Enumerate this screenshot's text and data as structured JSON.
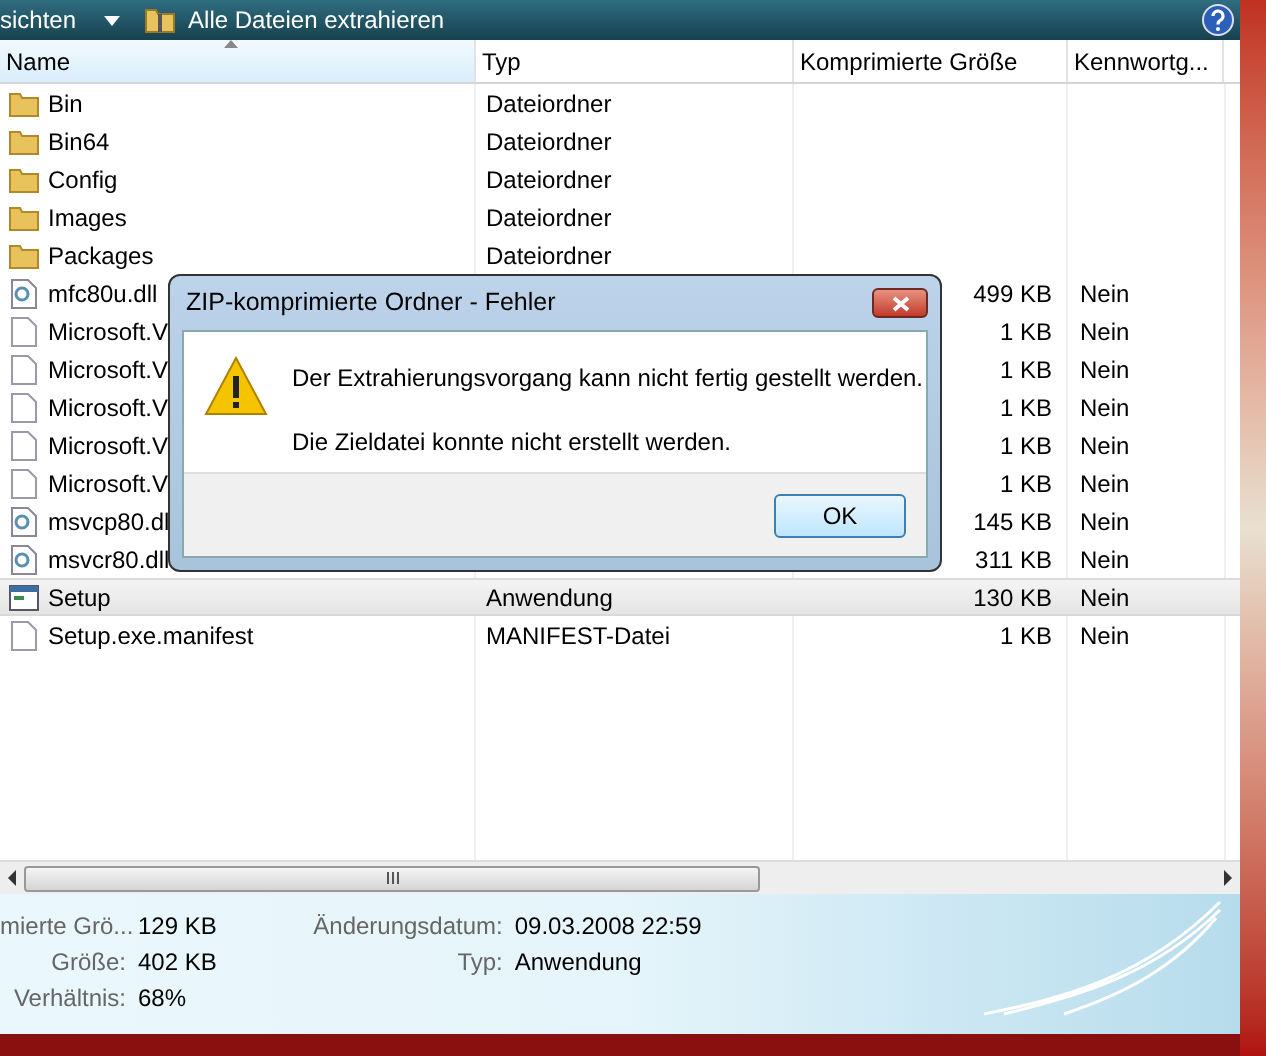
{
  "toolbar": {
    "items": [
      {
        "kind": "menu",
        "label": "sichten"
      },
      {
        "kind": "extract",
        "label": "Alle Dateien extrahieren"
      }
    ]
  },
  "table": {
    "columns": [
      "Name",
      "Typ",
      "Komprimierte Größe",
      "Kennwortg..."
    ],
    "rows": [
      {
        "kind": "folder",
        "name": "Bin",
        "type": "Dateiordner",
        "selected": false
      },
      {
        "kind": "folder",
        "name": "Bin64",
        "type": "Dateiordner",
        "selected": false
      },
      {
        "kind": "folder",
        "name": "Config",
        "type": "Dateiordner",
        "selected": false
      },
      {
        "kind": "folder",
        "name": "Images",
        "type": "Dateiordner",
        "selected": false
      },
      {
        "kind": "folder",
        "name": "Packages",
        "type": "Dateiordner",
        "selected": false
      },
      {
        "kind": "dll",
        "name": "mfc80u.dll",
        "size": "499 KB",
        "password": "Nein",
        "selected": false
      },
      {
        "kind": "file",
        "name": "Microsoft.V",
        "size": "1 KB",
        "password": "Nein",
        "selected": false
      },
      {
        "kind": "file",
        "name": "Microsoft.V",
        "size": "1 KB",
        "password": "Nein",
        "selected": false
      },
      {
        "kind": "file",
        "name": "Microsoft.V",
        "size": "1 KB",
        "password": "Nein",
        "selected": false
      },
      {
        "kind": "file",
        "name": "Microsoft.V",
        "size": "1 KB",
        "password": "Nein",
        "selected": false
      },
      {
        "kind": "file",
        "name": "Microsoft.V",
        "size": "1 KB",
        "password": "Nein",
        "selected": false
      },
      {
        "kind": "dll",
        "name": "msvcp80.dl",
        "size": "145 KB",
        "password": "Nein",
        "selected": false
      },
      {
        "kind": "dll",
        "name": "msvcr80.dll",
        "size": "311 KB",
        "password": "Nein",
        "selected": false
      },
      {
        "kind": "app",
        "name": "Setup",
        "type": "Anwendung",
        "size": "130 KB",
        "password": "Nein",
        "selected": true
      },
      {
        "kind": "file",
        "name": "Setup.exe.manifest",
        "type": "MANIFEST-Datei",
        "size": "1 KB",
        "password": "Nein",
        "selected": false
      }
    ]
  },
  "details": {
    "left": [
      {
        "label": "mierte Grö...",
        "value": "129 KB"
      },
      {
        "label": "Größe:",
        "value": "402 KB"
      },
      {
        "label": "Verhältnis:",
        "value": "68%"
      }
    ],
    "right": [
      {
        "label": "Änderungsdatum:",
        "value": "09.03.2008 22:59"
      },
      {
        "label": "Typ:",
        "value": "Anwendung"
      }
    ]
  },
  "dialog": {
    "title": "ZIP-komprimierte Ordner - Fehler",
    "message": "Der Extrahierungsvorgang kann nicht fertig gestellt werden.",
    "detail": "Die Zieldatei konnte nicht erstellt werden.",
    "button": "OK"
  }
}
